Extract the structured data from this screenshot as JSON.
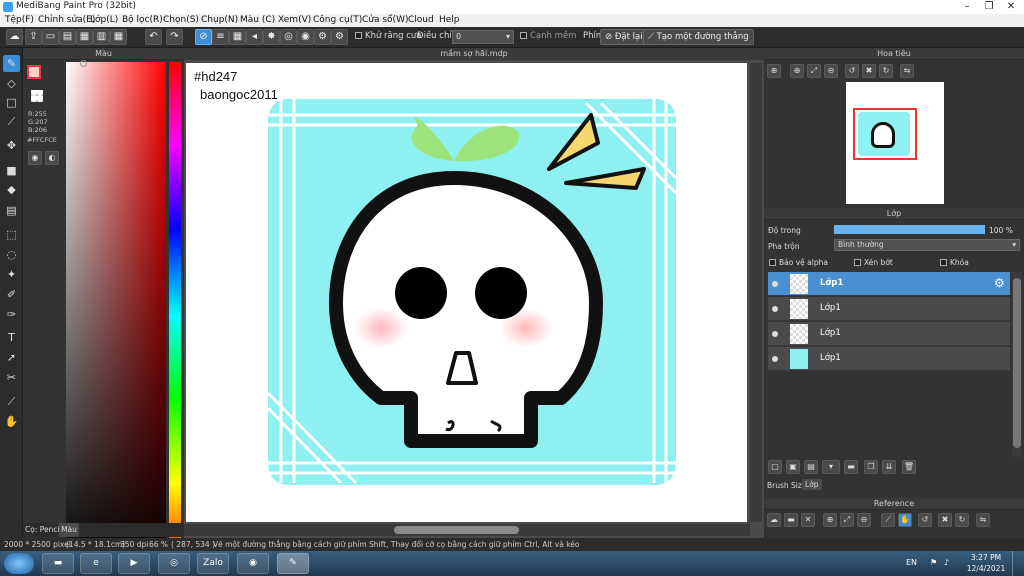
{
  "window": {
    "title": "MediBang Paint Pro (32bit)"
  },
  "menu": [
    "Tệp(F)",
    "Chỉnh sửa(E)",
    "Lớp(L)",
    "Bộ lọc(R)",
    "Chọn(S)",
    "Chụp(N)",
    "Màu (C)",
    "Xem(V)",
    "Công cụ(T)",
    "Cửa sổ(W)",
    "Cloud",
    "Help"
  ],
  "toolbar": {
    "antialias_label": "Khử răng cưa",
    "correction_label": "Điều chỉnh",
    "correction_value": "0",
    "edge_label": "Cạnh mềm",
    "key_label": "Phím",
    "reset_label": "Đặt lại",
    "make_line_label": "Tạo một đường thẳng"
  },
  "color_panel": {
    "title": "Màu",
    "rgb": [
      "R:255",
      "G:207",
      "B:206"
    ],
    "hex": "#FFCFCE",
    "tabs": [
      "Cọ: Pencil",
      "Màu"
    ]
  },
  "document": {
    "tab_title": "mầm sợ hãi.mdp",
    "text_line1": "#hd247",
    "text_line2": "baongoc2011"
  },
  "navigator": {
    "title": "Hoa tiêu"
  },
  "layers_panel": {
    "title": "Lớp",
    "opacity_label": "Độ trong",
    "opacity_value": "100 %",
    "opacity_fraction": 1.0,
    "blend_label": "Pha trộn",
    "blend_value": "Bình thường",
    "protect_alpha": "Bảo vệ alpha",
    "clipping": "Xén bớt",
    "lock": "Khóa",
    "layers": [
      {
        "name": "Lớp1",
        "selected": true
      },
      {
        "name": "Lớp1",
        "selected": false
      },
      {
        "name": "Lớp1",
        "selected": false
      },
      {
        "name": "Lớp1",
        "selected": false
      }
    ],
    "bottom_tabs": [
      "Brush Size",
      "Lớp"
    ]
  },
  "reference": {
    "title": "Reference"
  },
  "status": {
    "size": "2000 * 2500 pixel",
    "cm": "(14.5 * 18.1cm)",
    "dpi": "350 dpi",
    "zoom": "66 %",
    "coords": "( 287, 534 )",
    "hint": "Vẽ một đường thẳng bằng cách giữ phím Shift, Thay đổi cỡ cọ bằng cách giữ phím Ctrl, Alt và kéo"
  },
  "taskbar": {
    "lang": "EN",
    "time": "3:27 PM",
    "date": "12/4/2021",
    "zalo_label": "Zalo"
  },
  "colors": {
    "foreground": "#FFCFCE",
    "canvas_bg": "#8ef0f0",
    "leaf": "#9be37a",
    "accent": "#3c8fd6"
  }
}
